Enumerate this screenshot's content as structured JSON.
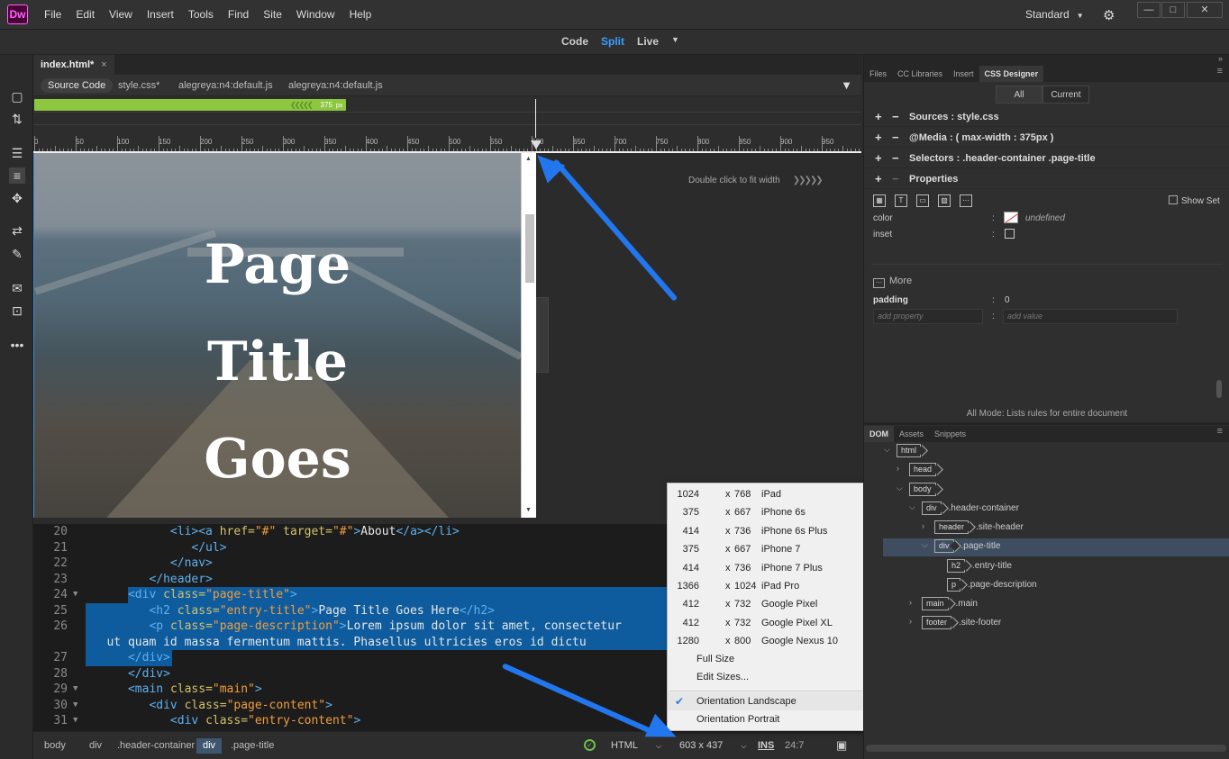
{
  "app": {
    "logo": "Dw",
    "workspace": "Standard"
  },
  "menu": [
    "File",
    "Edit",
    "View",
    "Insert",
    "Tools",
    "Find",
    "Site",
    "Window",
    "Help"
  ],
  "view_modes": {
    "code": "Code",
    "split": "Split",
    "live": "Live"
  },
  "document": {
    "tab": "index.html*",
    "close": "×",
    "related_files": [
      "Source Code",
      "style.css*",
      "alegreya:n4:default.js",
      "alegreya:n4:default.js"
    ]
  },
  "media_query_bar": {
    "label": "375",
    "unit": "px",
    "fraction_of_ruler": 0.39
  },
  "ruler_ticks": [
    "0",
    "50",
    "100",
    "150",
    "200",
    "250",
    "300",
    "350",
    "400",
    "450",
    "500",
    "550",
    "600",
    "650",
    "700",
    "750",
    "800",
    "850",
    "900",
    "950"
  ],
  "design_view": {
    "title_lines": [
      "Page",
      "Title",
      "Goes"
    ],
    "fit_hint": "Double click to fit width"
  },
  "code_lines": [
    {
      "n": "20",
      "fold": "",
      "parts": [
        [
          "",
          "            "
        ],
        [
          "tag",
          "<li><a "
        ],
        [
          "atr",
          "href="
        ],
        [
          "str",
          "\"#\""
        ],
        [
          "atr",
          " target="
        ],
        [
          "str",
          "\"#\""
        ],
        [
          "tag",
          ">"
        ],
        [
          "txt",
          "About"
        ],
        [
          "tag",
          "</a></li>"
        ]
      ]
    },
    {
      "n": "21",
      "fold": "",
      "parts": [
        [
          "",
          "               "
        ],
        [
          "tag",
          "</ul>"
        ]
      ]
    },
    {
      "n": "22",
      "fold": "",
      "parts": [
        [
          "",
          "            "
        ],
        [
          "tag",
          "</nav>"
        ]
      ]
    },
    {
      "n": "23",
      "fold": "",
      "parts": [
        [
          "",
          "         "
        ],
        [
          "tag",
          "</header>"
        ]
      ]
    },
    {
      "n": "24",
      "fold": "▼",
      "sel": true,
      "parts": [
        [
          "",
          "      "
        ],
        [
          "tag",
          "<div "
        ],
        [
          "atr",
          "class="
        ],
        [
          "str",
          "\"page-title\""
        ],
        [
          "tag",
          ">"
        ]
      ]
    },
    {
      "n": "25",
      "fold": "",
      "sel": true,
      "parts": [
        [
          "",
          "         "
        ],
        [
          "tag",
          "<h2 "
        ],
        [
          "atr",
          "class="
        ],
        [
          "str",
          "\"entry-title\""
        ],
        [
          "tag",
          ">"
        ],
        [
          "txt",
          "Page Title Goes Here"
        ],
        [
          "tag",
          "</h2>"
        ]
      ]
    },
    {
      "n": "26",
      "fold": "",
      "sel": true,
      "parts": [
        [
          "",
          "         "
        ],
        [
          "tag",
          "<p "
        ],
        [
          "atr",
          "class="
        ],
        [
          "str",
          "\"page-description\""
        ],
        [
          "tag",
          ">"
        ],
        [
          "txt",
          "Lorem ipsum dolor sit amet, consectetur"
        ]
      ]
    },
    {
      "n": "",
      "fold": "",
      "sel": true,
      "parts": [
        [
          "",
          "   "
        ],
        [
          "txt",
          "ut quam id massa fermentum mattis. Phasellus ultricies eros id dictu"
        ]
      ]
    },
    {
      "n": "27",
      "fold": "",
      "sel": true,
      "parts": [
        [
          "",
          "      "
        ],
        [
          "tag",
          "</div>"
        ]
      ]
    },
    {
      "n": "28",
      "fold": "",
      "parts": [
        [
          "",
          "      "
        ],
        [
          "tag",
          "</div>"
        ]
      ]
    },
    {
      "n": "29",
      "fold": "▼",
      "parts": [
        [
          "",
          "      "
        ],
        [
          "tag",
          "<main "
        ],
        [
          "atr",
          "class="
        ],
        [
          "str",
          "\"main\""
        ],
        [
          "tag",
          ">"
        ]
      ]
    },
    {
      "n": "30",
      "fold": "▼",
      "parts": [
        [
          "",
          "         "
        ],
        [
          "tag",
          "<div "
        ],
        [
          "atr",
          "class="
        ],
        [
          "str",
          "\"page-content\""
        ],
        [
          "tag",
          ">"
        ]
      ]
    },
    {
      "n": "31",
      "fold": "▼",
      "parts": [
        [
          "",
          "            "
        ],
        [
          "tag",
          "<div "
        ],
        [
          "atr",
          "class="
        ],
        [
          "str",
          "\"entry-content\""
        ],
        [
          "tag",
          ">"
        ]
      ]
    }
  ],
  "status_bar": {
    "breadcrumbs": [
      "body",
      "div",
      ".header-container",
      "div",
      ".page-title"
    ],
    "language": "HTML",
    "size": "603 x 437",
    "ins": "INS",
    "position": "24:7"
  },
  "size_menu": {
    "devices": [
      {
        "w": "1024",
        "h": "768",
        "name": "iPad"
      },
      {
        "w": "375",
        "h": "667",
        "name": "iPhone 6s"
      },
      {
        "w": "414",
        "h": "736",
        "name": "iPhone 6s Plus"
      },
      {
        "w": "375",
        "h": "667",
        "name": "iPhone 7"
      },
      {
        "w": "414",
        "h": "736",
        "name": "iPhone 7 Plus"
      },
      {
        "w": "1366",
        "h": "1024",
        "name": "iPad Pro"
      },
      {
        "w": "412",
        "h": "732",
        "name": "Google Pixel"
      },
      {
        "w": "412",
        "h": "732",
        "name": "Google Pixel XL"
      },
      {
        "w": "1280",
        "h": "800",
        "name": "Google Nexus 10"
      }
    ],
    "x": "x",
    "full_size": "Full Size",
    "edit_sizes": "Edit Sizes...",
    "orientation_landscape": "Orientation Landscape",
    "orientation_portrait": "Orientation Portrait"
  },
  "right_panel": {
    "top_tabs": [
      "Files",
      "CC Libraries",
      "Insert",
      "CSS Designer"
    ],
    "filter": {
      "all": "All",
      "current": "Current"
    },
    "sources": "Sources :  style.css",
    "media": "@Media :  ( max-width : 375px )",
    "selectors": "Selectors :  .header-container .page-title",
    "properties": "Properties",
    "show_set": "Show Set",
    "color_label": "color",
    "color_value": "undefined",
    "inset_label": "inset",
    "more": "More",
    "padding_label": "padding",
    "padding_value": "0",
    "add_property": "add property",
    "add_value": "add value",
    "colon": ":",
    "all_mode": "All Mode: Lists rules for entire document"
  },
  "dom_panel": {
    "tabs": [
      "DOM",
      "Assets",
      "Snippets"
    ],
    "nodes": [
      {
        "tag": "html",
        "cls": ""
      },
      {
        "tag": "head",
        "cls": ""
      },
      {
        "tag": "body",
        "cls": ""
      },
      {
        "tag": "div",
        "cls": ".header-container"
      },
      {
        "tag": "header",
        "cls": ".site-header"
      },
      {
        "tag": "div",
        "cls": ".page-title"
      },
      {
        "tag": "h2",
        "cls": ".entry-title"
      },
      {
        "tag": "p",
        "cls": ".page-description"
      },
      {
        "tag": "main",
        "cls": ".main"
      },
      {
        "tag": "footer",
        "cls": ".site-footer"
      }
    ]
  },
  "colors": {
    "accent": "#3b9dff",
    "mq_bar": "#8dc63f",
    "arrow": "#2277ee",
    "selection": "#0e5c9e"
  }
}
